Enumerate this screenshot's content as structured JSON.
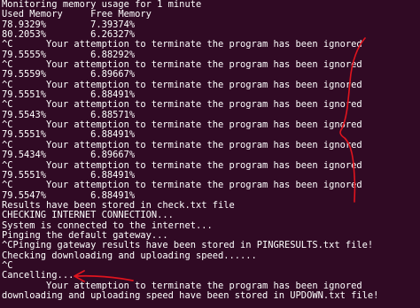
{
  "terminal": {
    "lines": [
      "Monitoring memory usage for 1 minute",
      "Used Memory     Free Memory",
      "78.9329%        7.39374%",
      "80.2053%        6.26327%",
      "^C      Your attemption to terminate the program has been ignored",
      "79.5555%        6.88292%",
      "^C      Your attemption to terminate the program has been ignored",
      "79.5559%        6.89667%",
      "^C      Your attemption to terminate the program has been ignored",
      "79.5551%        6.88491%",
      "^C      Your attemption to terminate the program has been ignored",
      "79.5543%        6.88571%",
      "^C      Your attemption to terminate the program has been ignored",
      "79.5551%        6.88491%",
      "^C      Your attemption to terminate the program has been ignored",
      "79.5434%        6.89667%",
      "^C      Your attemption to terminate the program has been ignored",
      "79.5551%        6.88491%",
      "^C      Your attemption to terminate the program has been ignored",
      "79.5547%        6.88491%",
      "Results have been stored in check.txt file",
      "CHECKING INTERNET CONNECTION...",
      "System is connected to the internet...",
      "Pinging the default gateway...",
      "^CPinging gateway results have been stored in PINGRESULTS.txt file!",
      "Checking downloading and uploading speed......",
      "^C",
      "Cancelling...",
      "        Your attemption to terminate the program has been ignored",
      "downloading and uploading speed have been stored in UPDOWN.txt file!"
    ]
  },
  "annotation": {
    "color": "#e0141e"
  }
}
